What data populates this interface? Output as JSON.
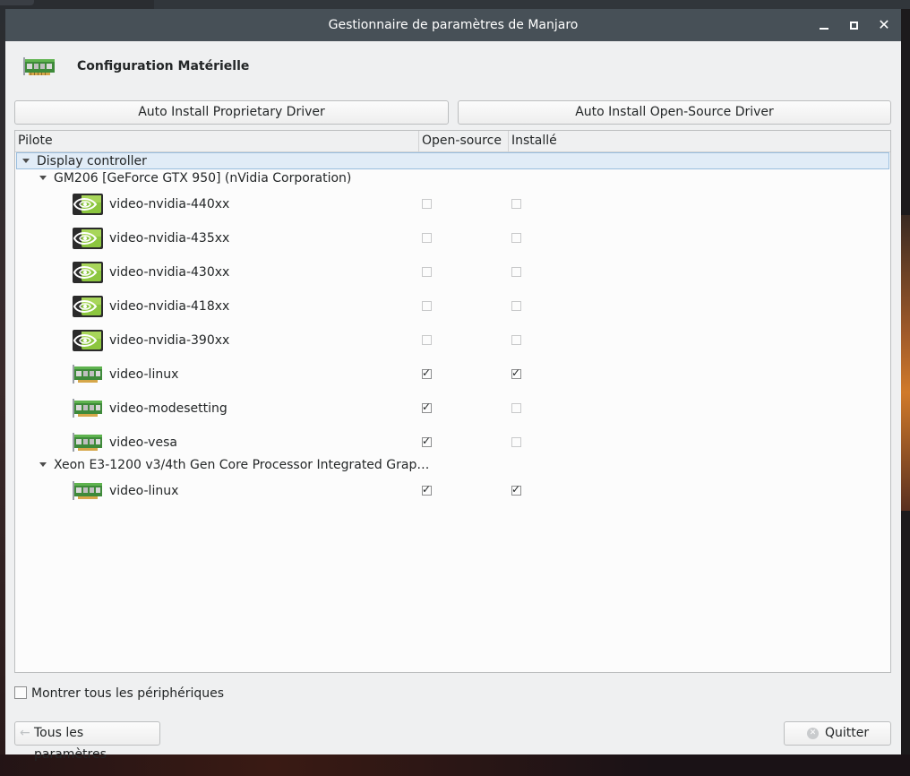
{
  "window": {
    "title": "Gestionnaire de paramètres de Manjaro"
  },
  "header": {
    "title": "Configuration Matérielle",
    "icon": "video-card-icon"
  },
  "toolbar": {
    "auto_proprietary": "Auto Install Proprietary Driver",
    "auto_open_source": "Auto Install Open-Source Driver"
  },
  "tree": {
    "columns": [
      "Pilote",
      "Open-source",
      "Installé"
    ],
    "category": "Display controller",
    "devices": [
      {
        "name": "GM206 [GeForce GTX 950] (nVidia Corporation)",
        "drivers": [
          {
            "name": "video-nvidia-440xx",
            "icon": "nvidia-icon",
            "open_source": false,
            "installed": false
          },
          {
            "name": "video-nvidia-435xx",
            "icon": "nvidia-icon",
            "open_source": false,
            "installed": false
          },
          {
            "name": "video-nvidia-430xx",
            "icon": "nvidia-icon",
            "open_source": false,
            "installed": false
          },
          {
            "name": "video-nvidia-418xx",
            "icon": "nvidia-icon",
            "open_source": false,
            "installed": false
          },
          {
            "name": "video-nvidia-390xx",
            "icon": "nvidia-icon",
            "open_source": false,
            "installed": false
          },
          {
            "name": "video-linux",
            "icon": "video-card-icon",
            "open_source": true,
            "installed": true
          },
          {
            "name": "video-modesetting",
            "icon": "video-card-icon",
            "open_source": true,
            "installed": false
          },
          {
            "name": "video-vesa",
            "icon": "video-card-icon",
            "open_source": true,
            "installed": false
          }
        ]
      },
      {
        "name": "Xeon E3-1200 v3/4th Gen Core Processor Integrated Grap…",
        "drivers": [
          {
            "name": "video-linux",
            "icon": "video-card-icon",
            "open_source": true,
            "installed": true
          }
        ]
      }
    ]
  },
  "footer": {
    "show_all_label": "Montrer tous les périphériques",
    "show_all_checked": false,
    "back_label": "Tous les paramètres",
    "quit_label": "Quitter"
  },
  "colors": {
    "titlebar": "#475057",
    "selection": "#e1ecf7",
    "nvidia_green": "#76b900"
  }
}
